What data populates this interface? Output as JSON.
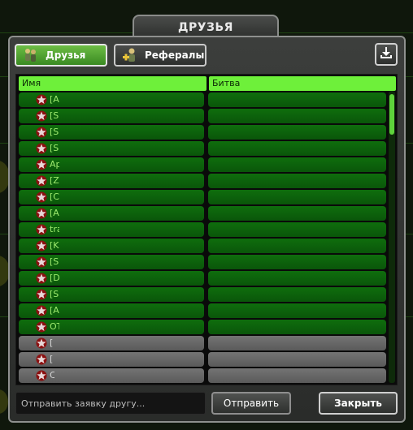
{
  "dialog": {
    "title": "ДРУЗЬЯ"
  },
  "tabs": [
    {
      "label": "Друзья",
      "icon": "soldiers-icon",
      "active": true
    },
    {
      "label": "Рефералы",
      "icon": "add-user-icon",
      "active": false
    }
  ],
  "toolbar": {
    "download_icon": "download-icon"
  },
  "table": {
    "columns": [
      "Имя",
      "Битва"
    ],
    "rows": [
      {
        "name": "[A",
        "status": "online"
      },
      {
        "name": "[S",
        "status": "online"
      },
      {
        "name": "[S",
        "status": "online"
      },
      {
        "name": "[S",
        "status": "online"
      },
      {
        "name": "Ap",
        "status": "online"
      },
      {
        "name": "[Z",
        "status": "online"
      },
      {
        "name": "[C",
        "status": "online"
      },
      {
        "name": "[A",
        "status": "online"
      },
      {
        "name": "tra",
        "status": "online"
      },
      {
        "name": "[K",
        "status": "online"
      },
      {
        "name": "[S",
        "status": "online"
      },
      {
        "name": "[D",
        "status": "online"
      },
      {
        "name": "[S",
        "status": "online"
      },
      {
        "name": "[A",
        "status": "online"
      },
      {
        "name": "OT",
        "status": "online"
      },
      {
        "name": "[",
        "status": "offline"
      },
      {
        "name": "[",
        "status": "offline"
      },
      {
        "name": "C",
        "status": "offline"
      }
    ]
  },
  "footer": {
    "input_placeholder": "Отправить заявку другу...",
    "send_label": "Отправить",
    "close_label": "Закрыть"
  },
  "colors": {
    "accent_green": "#6ef03a",
    "online_row": "#0f6e0d",
    "offline_row": "#6a6a6a"
  }
}
